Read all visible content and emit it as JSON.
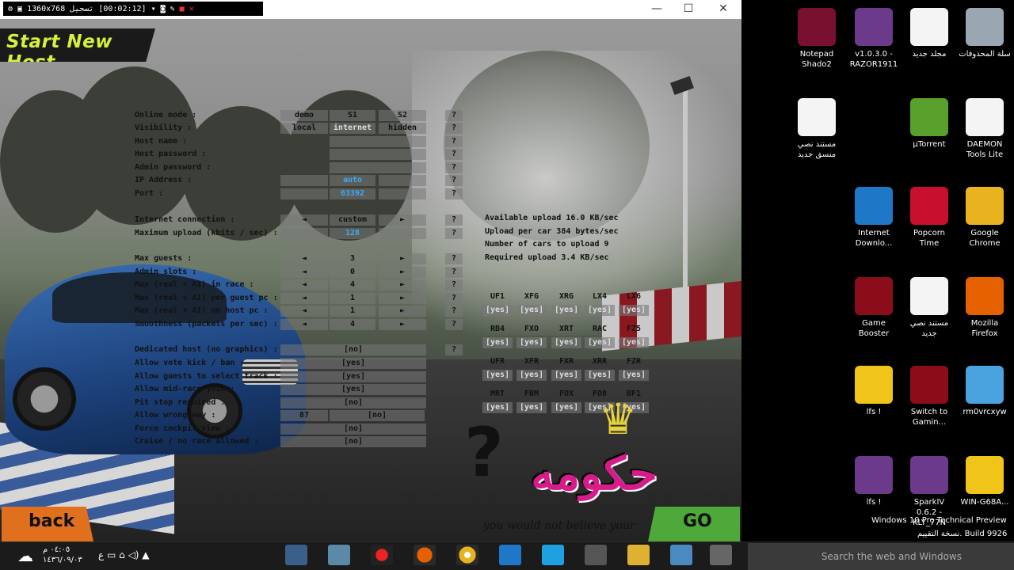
{
  "window": {
    "minimize": "—",
    "maximize": "☐",
    "close": "✕"
  },
  "recorder": {
    "resolution": "1360x768",
    "label": "تسجيل",
    "time": "[00:02:12]"
  },
  "game": {
    "heading": "Start New Host",
    "back": "back",
    "go": "GO",
    "logo_text": "حكومه",
    "tagline": "you would not believe your",
    "rows": [
      {
        "label": "Online mode :",
        "cells": [
          "demo",
          "S1",
          "S2"
        ],
        "q": "?"
      },
      {
        "label": "Visibility :",
        "cells": [
          "local",
          "internet",
          "hidden"
        ],
        "q": "?"
      },
      {
        "label": "Host name :",
        "cells": [
          ""
        ],
        "q": "?"
      },
      {
        "label": "Host password :",
        "cells": [
          ""
        ],
        "q": "?"
      },
      {
        "label": "Admin password :",
        "cells": [
          ""
        ],
        "q": "?"
      },
      {
        "label": "IP Address :",
        "cells": [
          "",
          "auto",
          ""
        ],
        "q": "?"
      },
      {
        "label": "Port :",
        "cells": [
          "",
          "63392",
          ""
        ],
        "q": "?"
      },
      {
        "label": "Internet connection :",
        "cells": [
          "◄",
          "custom",
          "►"
        ],
        "q": "?"
      },
      {
        "label": "Maximum upload (kbits / sec) :",
        "cells": [
          "",
          "128",
          ""
        ],
        "q": "?"
      },
      {
        "label": "Max guests :",
        "cells": [
          "◄",
          "3",
          "►"
        ],
        "q": "?"
      },
      {
        "label": "Admin slots :",
        "cells": [
          "◄",
          "0",
          "►"
        ],
        "q": "?"
      },
      {
        "label": "Max (real + AI) in race :",
        "cells": [
          "◄",
          "4",
          "►"
        ],
        "q": "?"
      },
      {
        "label": "Max (real + AI) per guest pc :",
        "cells": [
          "◄",
          "1",
          "►"
        ],
        "q": "?"
      },
      {
        "label": "Max (real + AI) on host pc :",
        "cells": [
          "◄",
          "1",
          "►"
        ],
        "q": "?"
      },
      {
        "label": "Smoothness (packets per sec) :",
        "cells": [
          "◄",
          "4",
          "►"
        ],
        "q": "?"
      },
      {
        "label": "Dedicated host (no graphics) :",
        "cells": [
          "[no]"
        ],
        "q": "?"
      },
      {
        "label": "Allow vote kick / ban :",
        "cells": [
          "[yes]"
        ],
        "q": ""
      },
      {
        "label": "Allow guests to select track :",
        "cells": [
          "[yes]"
        ],
        "q": ""
      },
      {
        "label": "Allow mid-race join :",
        "cells": [
          "[yes]"
        ],
        "q": ""
      },
      {
        "label": "Pit stop required :",
        "cells": [
          "[no]"
        ],
        "q": ""
      },
      {
        "label": "Allow wrong way :",
        "cells": [
          "87",
          "[no]"
        ],
        "q": ""
      },
      {
        "label": "Force cockpit view :",
        "cells": [
          "[no]"
        ],
        "q": ""
      },
      {
        "label": "Cruise / no race allowed :",
        "cells": [
          "[no]"
        ],
        "q": ""
      }
    ],
    "info": [
      "Available upload 16.0 KB/sec",
      "Upload per car 384 bytes/sec",
      "Number of cars to upload 9",
      "Required upload 3.4 KB/sec"
    ],
    "cars": [
      [
        "UF1",
        "XFG",
        "XRG",
        "LX4",
        "LX6"
      ],
      [
        "RB4",
        "FXO",
        "XRT",
        "RAC",
        "FZ5"
      ],
      [
        "UFR",
        "XFR",
        "FXR",
        "XRR",
        "FZR"
      ],
      [
        "MRT",
        "FBM",
        "FOX",
        "FO8",
        "BF1"
      ]
    ],
    "car_value": "[yes]"
  },
  "desktop": {
    "icons": [
      {
        "name": "Notepad Shado2",
        "color": "#7a1030"
      },
      {
        "name": "v1.0.3.0 - RAZOR1911",
        "color": "#6b3a8a"
      },
      {
        "name": "مجلد جديد",
        "color": "#f4f4f4"
      },
      {
        "name": "سلة المحذوفات",
        "color": "#9aa6b2"
      },
      {
        "name": "مستند نصي منسق جديد",
        "color": "#f4f4f4"
      },
      {
        "name": "µTorrent",
        "color": "#5aa02c"
      },
      {
        "name": "DAEMON Tools Lite",
        "color": "#f4f4f4"
      },
      {
        "name": "Internet Downlo...",
        "color": "#1f77c8"
      },
      {
        "name": "Popcorn Time",
        "color": "#c8102e"
      },
      {
        "name": "Google Chrome",
        "color": "#e9b21f"
      },
      {
        "name": "Game Booster",
        "color": "#8b0d1a"
      },
      {
        "name": "مستند نصي جديد",
        "color": "#f4f4f4"
      },
      {
        "name": "Mozilla Firefox",
        "color": "#e66000"
      },
      {
        "name": "lfs !",
        "color": "#f0c419"
      },
      {
        "name": "Switch to Gamin...",
        "color": "#8b0d1a"
      },
      {
        "name": "rm0vrcxyw",
        "color": "#4aa3df"
      },
      {
        "name": "lfs !",
        "color": "#6b3a8a"
      },
      {
        "name": "SparkIV 0.6.2 - KLY_77N",
        "color": "#6b3a8a"
      },
      {
        "name": "WIN-G68A...",
        "color": "#f0c419"
      }
    ],
    "watermark_line1": "Windows 10 Pro Technical Preview",
    "watermark_line2": "نسخة التقييم. Build 9926"
  },
  "taskbar": {
    "search_placeholder": "Search the web and Windows",
    "time": "٠٤:٠٥ م",
    "date": "١٤٣٦/٠٩/٠٣",
    "tray": "ع  ▭ ⌂ ◁) ▲"
  }
}
